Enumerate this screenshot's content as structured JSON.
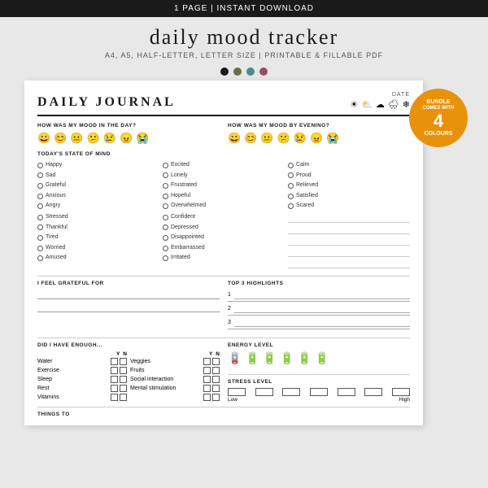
{
  "banner": {
    "text": "1 PAGE | INSTANT DOWNLOAD"
  },
  "title": {
    "main": "daily mood tracker",
    "subtitle": "A4, A5, HALF-LETTER, LETTER SIZE  |  PRINTABLE & FILLABLE PDF"
  },
  "colors": [
    {
      "name": "black",
      "hex": "#1a1a1a"
    },
    {
      "name": "olive",
      "hex": "#6b7040"
    },
    {
      "name": "teal",
      "hex": "#4a8a8a"
    },
    {
      "name": "mauve",
      "hex": "#9c4a6a"
    }
  ],
  "bundle_badge": {
    "line1": "BUNDLE",
    "line2": "COMES WITH",
    "number": "4",
    "line3": "COLOURS"
  },
  "journal": {
    "title": "DAILY JOURNAL",
    "date_label": "DATE",
    "weather_icons": [
      "☀",
      "⛅",
      "☁",
      "🌧",
      "❄"
    ],
    "mood_day_label": "HOW WAS MY MOOD IN THE DAY?",
    "mood_evening_label": "HOW WAS MY MOOD BY EVENING?",
    "mood_emojis_day": [
      "😀",
      "😊",
      "😐",
      "😕",
      "😢",
      "😠",
      "😭"
    ],
    "mood_emojis_evening": [
      "😀",
      "😊",
      "😐",
      "😕",
      "😢",
      "😠",
      "😭"
    ],
    "state_label": "TODAY'S STATE OF MIND",
    "states_col1": [
      "Happy",
      "Sad",
      "Grateful",
      "Anxious",
      "Angry"
    ],
    "states_col2": [
      "Excited",
      "Lonely",
      "Frustrated",
      "Hopeful",
      "Overwhelmed"
    ],
    "states_col3": [
      "Calm",
      "Proud",
      "Relieved",
      "Satisfied",
      "Scared"
    ],
    "states_col4": [
      "Stressed",
      "Thankful",
      "Tired",
      "Worried",
      "Amused"
    ],
    "states_col5": [
      "Confident",
      "Depressed",
      "Disappointed",
      "Embarrassed",
      "Irritated"
    ],
    "grateful_label": "I FEEL GRATEFUL FOR",
    "highlights_label": "TOP 3 HIGHLIGHTS",
    "highlight_nums": [
      "1",
      "2",
      "3"
    ],
    "enough_label": "DID I HAVE ENOUGH...",
    "yn": "Y  N",
    "enough_items_left": [
      "Water",
      "Exercise",
      "Sleep",
      "Rest",
      "Vitamins"
    ],
    "enough_items_right": [
      "Veggies",
      "Fruits",
      "Social interaction",
      "Mental stimulation",
      ""
    ],
    "energy_label": "ENERGY LEVEL",
    "stress_label": "STRESS LEVEL",
    "stress_low": "Low",
    "stress_high": "High",
    "things_label": "THINGS TO"
  }
}
